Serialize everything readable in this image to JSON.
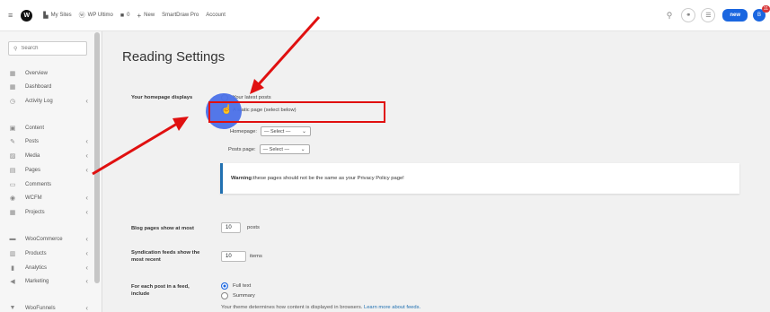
{
  "topbar": {
    "logo_text": "W",
    "items": [
      {
        "icon": "sites-icon",
        "label": "My Sites"
      },
      {
        "icon": "wordpress-icon",
        "label": "WP Ultimo"
      },
      {
        "icon": "comment-icon",
        "label": "0"
      },
      {
        "icon": "plus-icon",
        "label": "New"
      },
      {
        "icon": "",
        "label": "SmartDraw Pro"
      },
      {
        "icon": "",
        "label": "Account"
      }
    ],
    "new_button": "new",
    "avatar_initial": "B",
    "notification_count": "11"
  },
  "sidebar": {
    "search_placeholder": "Search",
    "items": [
      {
        "label": "Overview",
        "icon": "grid-icon",
        "has_chevron": false
      },
      {
        "label": "Dashboard",
        "icon": "dashboard-icon",
        "has_chevron": false
      },
      {
        "label": "Activity Log",
        "icon": "clock-icon",
        "has_chevron": true
      },
      {
        "label": "Content",
        "icon": "content-icon",
        "has_chevron": false
      },
      {
        "label": "Posts",
        "icon": "pin-icon",
        "has_chevron": true
      },
      {
        "label": "Media",
        "icon": "media-icon",
        "has_chevron": true
      },
      {
        "label": "Pages",
        "icon": "page-icon",
        "has_chevron": true
      },
      {
        "label": "Comments",
        "icon": "comment-icon",
        "has_chevron": false
      },
      {
        "label": "WCFM",
        "icon": "eye-icon",
        "has_chevron": true
      },
      {
        "label": "Projects",
        "icon": "grid-icon",
        "has_chevron": true
      },
      {
        "label": "WooCommerce",
        "icon": "woo-icon",
        "has_chevron": true
      },
      {
        "label": "Products",
        "icon": "products-icon",
        "has_chevron": true
      },
      {
        "label": "Analytics",
        "icon": "chart-icon",
        "has_chevron": true
      },
      {
        "label": "Marketing",
        "icon": "megaphone-icon",
        "has_chevron": true
      },
      {
        "label": "WooFunnels",
        "icon": "funnel-icon",
        "has_chevron": true
      }
    ]
  },
  "main": {
    "title": "Reading Settings",
    "homepage": {
      "label": "Your homepage displays",
      "opt_latest": "Your latest posts",
      "opt_static": "A static page (select below)",
      "homepage_label": "Homepage:",
      "homepage_value": "— Select —",
      "posts_label": "Posts page:",
      "posts_value": "— Select —"
    },
    "warning": {
      "strong": "Warning:",
      "text": " these pages should not be the same as your Privacy Policy page!"
    },
    "blog_pages": {
      "label": "Blog pages show at most",
      "value": "10",
      "suffix": "posts"
    },
    "syndication": {
      "label_line1": "Syndication feeds show the",
      "label_line2": "most recent",
      "value": "10",
      "suffix": "items"
    },
    "feed": {
      "label_line1": "For each post in a feed,",
      "label_line2": "include",
      "opt_full": "Full text",
      "opt_summary": "Summary",
      "hint_text": "Your theme determines how content is displayed in browsers. ",
      "hint_link": "Learn more about feeds."
    }
  },
  "annotation_color": "#e01010"
}
